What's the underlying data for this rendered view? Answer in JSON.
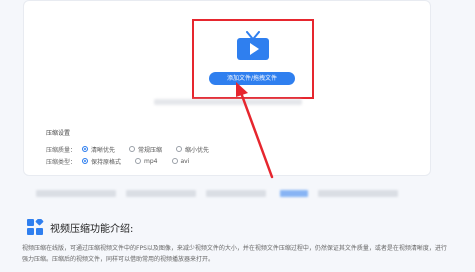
{
  "upload": {
    "add_button_label": "添加文件/拖拽文件"
  },
  "settings": {
    "heading": "压缩设置",
    "rows": [
      {
        "label": "压缩质量：",
        "options": [
          {
            "label": "清晰优先",
            "selected": true
          },
          {
            "label": "常规压缩",
            "selected": false
          },
          {
            "label": "缩小优先",
            "selected": false
          }
        ]
      },
      {
        "label": "压缩类型：",
        "options": [
          {
            "label": "保持原格式",
            "selected": true
          },
          {
            "label": "mp4",
            "selected": false
          },
          {
            "label": "avi",
            "selected": false
          }
        ]
      }
    ]
  },
  "intro": {
    "title": "视频压缩功能介绍:",
    "description": "视频压缩在线版，可通过压缩视频文件中的FPS以及图像，来减少视频文件的大小，并在视频文件压缩过程中，仍然保证其文件质量，或者是在视频清晰度，进行强力压缩。压缩后的视频文件，同样可以借助常用的视频播放器来打开。"
  },
  "colors": {
    "accent": "#2f7fef",
    "highlight": "#e6262e"
  }
}
